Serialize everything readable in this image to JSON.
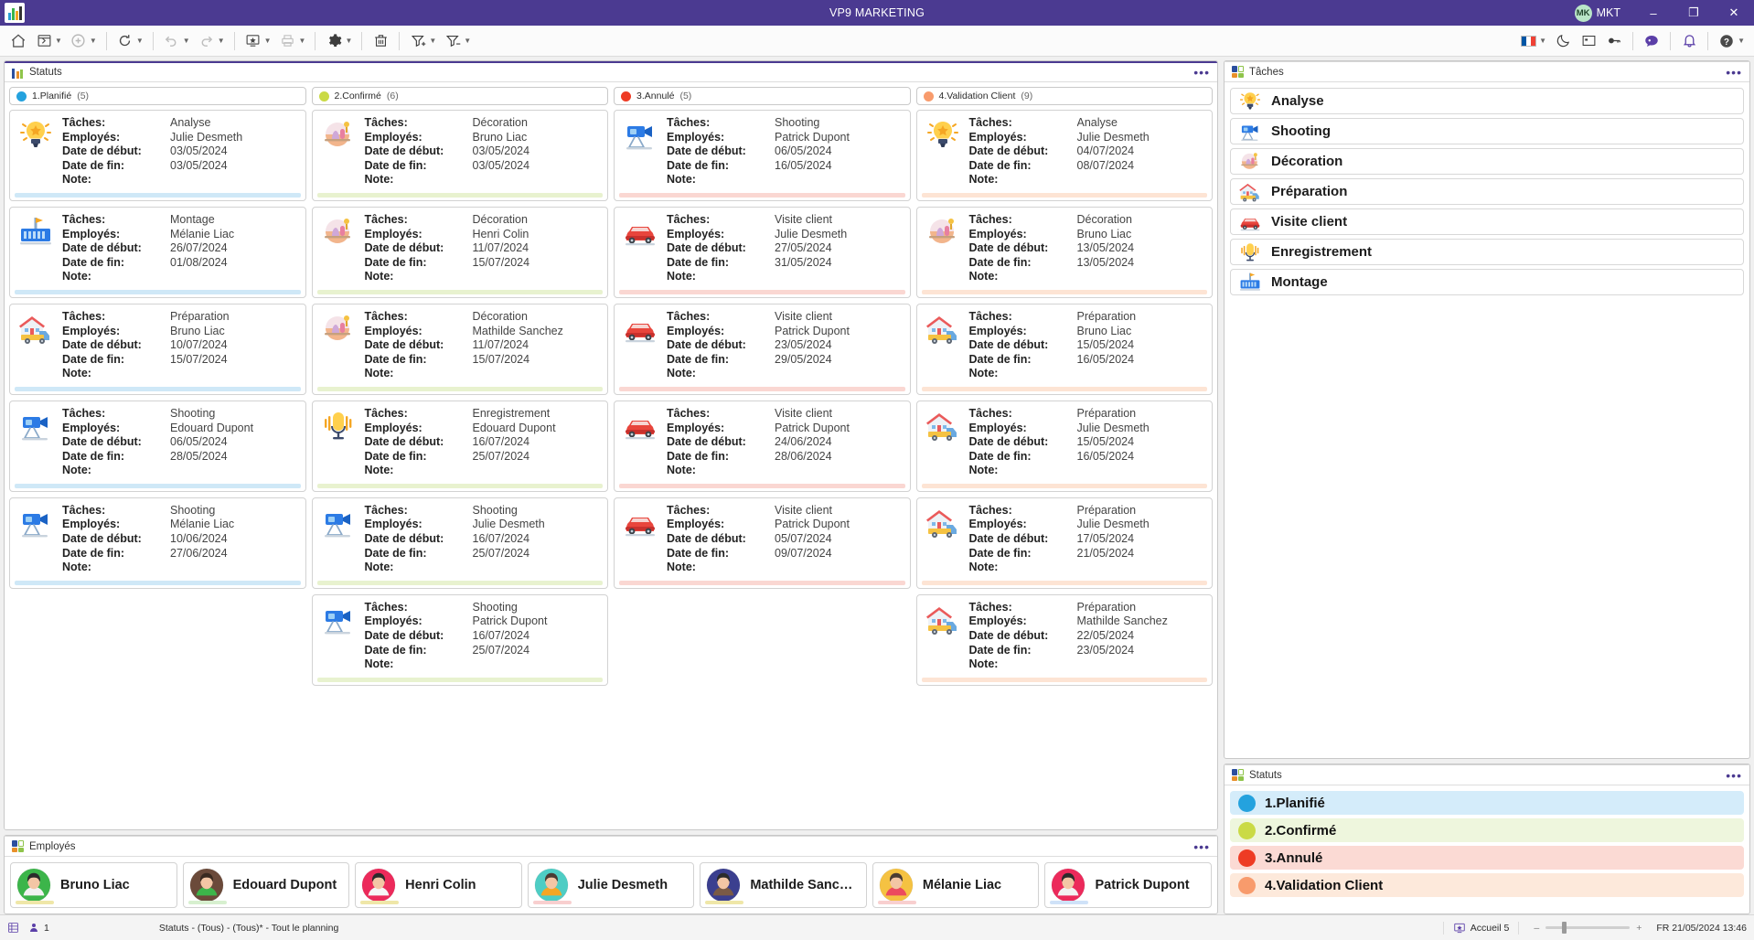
{
  "titlebar": {
    "app_title": "VP9 MARKETING",
    "user_initials": "MK",
    "user_name": "MKT",
    "minimize": "–",
    "maximize": "❐",
    "close": "✕",
    "accent_color": "#4b3a91"
  },
  "toolbar": {
    "items": [
      {
        "name": "home-icon",
        "caret": false
      },
      {
        "name": "new-window-icon",
        "caret": true
      },
      {
        "name": "add-circle-icon",
        "caret": true
      },
      {
        "name": "refresh-icon",
        "caret": true
      },
      {
        "name": "undo-icon",
        "caret": true
      },
      {
        "name": "redo-icon",
        "caret": true
      },
      {
        "name": "favorite-screen-icon",
        "caret": true
      },
      {
        "name": "print-icon",
        "caret": true
      },
      {
        "name": "settings-gear-icon",
        "caret": true
      },
      {
        "name": "trash-icon",
        "caret": false
      },
      {
        "name": "filter-add-icon",
        "caret": true
      },
      {
        "name": "filter-remove-icon",
        "caret": true
      }
    ],
    "right_items": [
      {
        "name": "language-flag-fr",
        "caret": true
      },
      {
        "name": "dark-mode-moon-icon",
        "caret": false
      },
      {
        "name": "window-layout-icon",
        "caret": false
      },
      {
        "name": "key-icon",
        "caret": false
      },
      {
        "name": "chat-bubble-icon",
        "caret": false
      },
      {
        "name": "notification-bell-icon",
        "caret": false
      },
      {
        "name": "help-icon",
        "caret": true
      }
    ]
  },
  "statuts_panel": {
    "title": "Statuts",
    "menu": "•••"
  },
  "taches_panel": {
    "title": "Tâches",
    "menu": "•••"
  },
  "statuts_side_panel": {
    "title": "Statuts",
    "menu": "•••"
  },
  "employes_panel": {
    "title": "Employés",
    "menu": "•••"
  },
  "field_labels": {
    "taches": "Tâches:",
    "employes": "Employés:",
    "date_debut": "Date de début:",
    "date_fin": "Date de fin:",
    "note": "Note:"
  },
  "kanban": {
    "columns": [
      {
        "label": "1.Planifié",
        "count": "(5)",
        "color": "#24a2de",
        "strip": "#cfe8f7",
        "cards": [
          {
            "icon": "lightbulb-icon",
            "tache": "Analyse",
            "employe": "Julie Desmeth",
            "debut": "03/05/2024",
            "fin": "03/05/2024",
            "note": ""
          },
          {
            "icon": "montage-icon",
            "tache": "Montage",
            "employe": "Mélanie Liac",
            "debut": "26/07/2024",
            "fin": "01/08/2024",
            "note": ""
          },
          {
            "icon": "truck-house-icon",
            "tache": "Préparation",
            "employe": "Bruno Liac",
            "debut": "10/07/2024",
            "fin": "15/07/2024",
            "note": ""
          },
          {
            "icon": "camera-icon",
            "tache": "Shooting",
            "employe": "Edouard Dupont",
            "debut": "06/05/2024",
            "fin": "28/05/2024",
            "note": ""
          },
          {
            "icon": "camera-icon",
            "tache": "Shooting",
            "employe": "Mélanie Liac",
            "debut": "10/06/2024",
            "fin": "27/06/2024",
            "note": ""
          }
        ]
      },
      {
        "label": "2.Confirmé",
        "count": "(6)",
        "color": "#cada45",
        "strip": "#e8f2cf",
        "cards": [
          {
            "icon": "decoration-icon",
            "tache": "Décoration",
            "employe": "Bruno Liac",
            "debut": "03/05/2024",
            "fin": "03/05/2024",
            "note": ""
          },
          {
            "icon": "decoration-icon",
            "tache": "Décoration",
            "employe": "Henri Colin",
            "debut": "11/07/2024",
            "fin": "15/07/2024",
            "note": ""
          },
          {
            "icon": "decoration-icon",
            "tache": "Décoration",
            "employe": "Mathilde Sanchez",
            "debut": "11/07/2024",
            "fin": "15/07/2024",
            "note": ""
          },
          {
            "icon": "microphone-icon",
            "tache": "Enregistrement",
            "employe": "Edouard Dupont",
            "debut": "16/07/2024",
            "fin": "25/07/2024",
            "note": ""
          },
          {
            "icon": "camera-icon",
            "tache": "Shooting",
            "employe": "Julie Desmeth",
            "debut": "16/07/2024",
            "fin": "25/07/2024",
            "note": ""
          },
          {
            "icon": "camera-icon",
            "tache": "Shooting",
            "employe": "Patrick Dupont",
            "debut": "16/07/2024",
            "fin": "25/07/2024",
            "note": ""
          }
        ]
      },
      {
        "label": "3.Annulé",
        "count": "(5)",
        "color": "#ee3b24",
        "strip": "#fad7d2",
        "cards": [
          {
            "icon": "camera-icon",
            "tache": "Shooting",
            "employe": "Patrick Dupont",
            "debut": "06/05/2024",
            "fin": "16/05/2024",
            "note": ""
          },
          {
            "icon": "car-icon",
            "tache": "Visite client",
            "employe": "Julie Desmeth",
            "debut": "27/05/2024",
            "fin": "31/05/2024",
            "note": ""
          },
          {
            "icon": "car-icon",
            "tache": "Visite client",
            "employe": "Patrick Dupont",
            "debut": "23/05/2024",
            "fin": "29/05/2024",
            "note": ""
          },
          {
            "icon": "car-icon",
            "tache": "Visite client",
            "employe": "Patrick Dupont",
            "debut": "24/06/2024",
            "fin": "28/06/2024",
            "note": ""
          },
          {
            "icon": "car-icon",
            "tache": "Visite client",
            "employe": "Patrick Dupont",
            "debut": "05/07/2024",
            "fin": "09/07/2024",
            "note": ""
          }
        ]
      },
      {
        "label": "4.Validation Client",
        "count": "(9)",
        "color": "#f89b6c",
        "strip": "#fde4d4",
        "cards": [
          {
            "icon": "lightbulb-icon",
            "tache": "Analyse",
            "employe": "Julie Desmeth",
            "debut": "04/07/2024",
            "fin": "08/07/2024",
            "note": ""
          },
          {
            "icon": "decoration-icon",
            "tache": "Décoration",
            "employe": "Bruno Liac",
            "debut": "13/05/2024",
            "fin": "13/05/2024",
            "note": ""
          },
          {
            "icon": "truck-house-icon",
            "tache": "Préparation",
            "employe": "Bruno Liac",
            "debut": "15/05/2024",
            "fin": "16/05/2024",
            "note": ""
          },
          {
            "icon": "truck-house-icon",
            "tache": "Préparation",
            "employe": "Julie Desmeth",
            "debut": "15/05/2024",
            "fin": "16/05/2024",
            "note": ""
          },
          {
            "icon": "truck-house-icon",
            "tache": "Préparation",
            "employe": "Julie Desmeth",
            "debut": "17/05/2024",
            "fin": "21/05/2024",
            "note": ""
          },
          {
            "icon": "truck-house-icon",
            "tache": "Préparation",
            "employe": "Mathilde Sanchez",
            "debut": "22/05/2024",
            "fin": "23/05/2024",
            "note": ""
          }
        ]
      }
    ]
  },
  "taches_list": [
    {
      "label": "Analyse",
      "icon": "lightbulb-icon"
    },
    {
      "label": "Shooting",
      "icon": "camera-icon"
    },
    {
      "label": "Décoration",
      "icon": "decoration-icon"
    },
    {
      "label": "Préparation",
      "icon": "truck-house-icon"
    },
    {
      "label": "Visite client",
      "icon": "car-icon"
    },
    {
      "label": "Enregistrement",
      "icon": "microphone-icon"
    },
    {
      "label": "Montage",
      "icon": "montage-icon"
    }
  ],
  "statuts_list": [
    {
      "label": "1.Planifié",
      "dot": "#24a2de",
      "bg": "#d4ecfa"
    },
    {
      "label": "2.Confirmé",
      "dot": "#cada45",
      "bg": "#eef6dd"
    },
    {
      "label": "3.Annulé",
      "dot": "#ee3b24",
      "bg": "#fbdad4"
    },
    {
      "label": "4.Validation Client",
      "dot": "#f89b6c",
      "bg": "#fde9db"
    }
  ],
  "employes_list": [
    {
      "name": "Bruno Liac",
      "bg": "#3cb54a",
      "hair": "#2b2b2b",
      "cloth": "#f2f2f2",
      "strip": "#efe7a8"
    },
    {
      "name": "Edouard Dupont",
      "bg": "#6b4a3a",
      "hair": "#3a2a20",
      "cloth": "#3cb54a",
      "strip": "#d7f0cf"
    },
    {
      "name": "Henri Colin",
      "bg": "#ec2a5b",
      "hair": "#2b2b2b",
      "cloth": "#f6f6f6",
      "strip": "#efe7a8"
    },
    {
      "name": "Julie Desmeth",
      "bg": "#4ecdc4",
      "hair": "#4a3b33",
      "cloth": "#f5a623",
      "strip": "#f8cfcf"
    },
    {
      "name": "Mathilde Sanchez",
      "bg": "#3b3f8f",
      "hair": "#2b2b2b",
      "cloth": "#7a5a45",
      "strip": "#efe7a8"
    },
    {
      "name": "Mélanie Liac",
      "bg": "#f5c242",
      "hair": "#4a3b33",
      "cloth": "#ec4b5e",
      "strip": "#f8cfcf"
    },
    {
      "name": "Patrick Dupont",
      "bg": "#ec2a5b",
      "hair": "#2b2b2b",
      "cloth": "#f2f2f2",
      "strip": "#cfe2f8"
    }
  ],
  "statusbar": {
    "user_count": "1",
    "path_text": "Statuts - (Tous) - (Tous)* - Tout le planning",
    "accueil_label": "Accueil 5",
    "zoom_minus": "–",
    "zoom_plus": "+",
    "datetime": "FR 21/05/2024 13:46"
  }
}
